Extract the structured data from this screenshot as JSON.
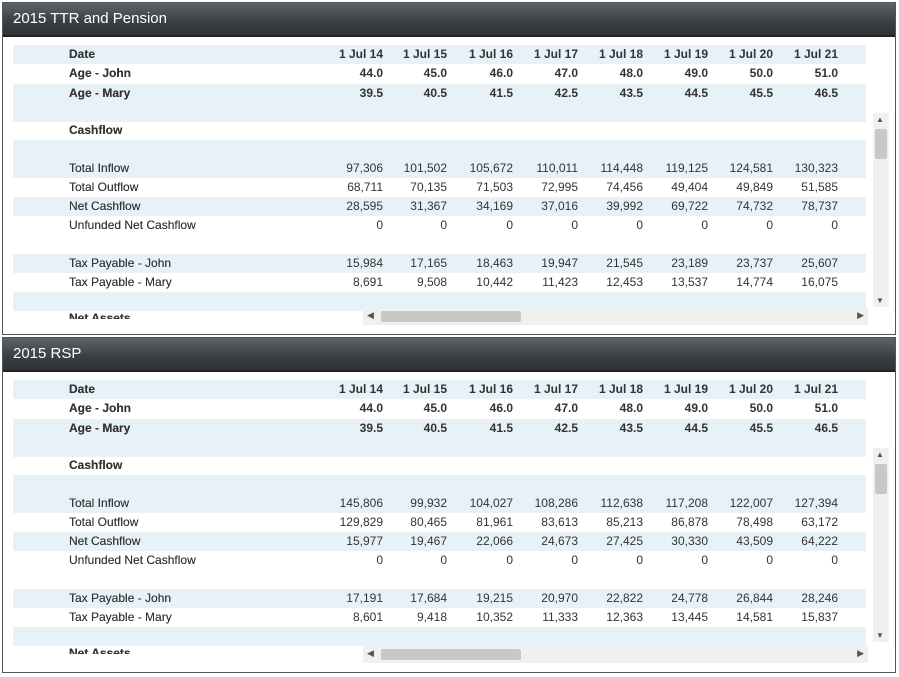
{
  "columns": [
    "1 Jul 14",
    "1 Jul 15",
    "1 Jul 16",
    "1 Jul 17",
    "1 Jul 18",
    "1 Jul 19",
    "1 Jul 20",
    "1 Jul 21"
  ],
  "panels": [
    {
      "title": "2015 TTR and Pension",
      "date_label": "Date",
      "age_rows": [
        {
          "label": "Age - John",
          "values": [
            "44.0",
            "45.0",
            "46.0",
            "47.0",
            "48.0",
            "49.0",
            "50.0",
            "51.0"
          ]
        },
        {
          "label": "Age - Mary",
          "values": [
            "39.5",
            "40.5",
            "41.5",
            "42.5",
            "43.5",
            "44.5",
            "45.5",
            "46.5"
          ]
        }
      ],
      "cashflow_label": "Cashflow",
      "cash_rows": [
        {
          "label": "Total Inflow",
          "values": [
            "97,306",
            "101,502",
            "105,672",
            "110,011",
            "114,448",
            "119,125",
            "124,581",
            "130,323"
          ]
        },
        {
          "label": "Total Outflow",
          "values": [
            "68,711",
            "70,135",
            "71,503",
            "72,995",
            "74,456",
            "49,404",
            "49,849",
            "51,585"
          ]
        },
        {
          "label": "Net Cashflow",
          "values": [
            "28,595",
            "31,367",
            "34,169",
            "37,016",
            "39,992",
            "69,722",
            "74,732",
            "78,737"
          ]
        },
        {
          "label": "Unfunded Net Cashflow",
          "values": [
            "0",
            "0",
            "0",
            "0",
            "0",
            "0",
            "0",
            "0"
          ]
        }
      ],
      "tax_rows": [
        {
          "label": "Tax Payable - John",
          "values": [
            "15,984",
            "17,165",
            "18,463",
            "19,947",
            "21,545",
            "23,189",
            "23,737",
            "25,607"
          ]
        },
        {
          "label": "Tax Payable - Mary",
          "values": [
            "8,691",
            "9,508",
            "10,442",
            "11,423",
            "12,453",
            "13,537",
            "14,774",
            "16,075"
          ]
        }
      ],
      "net_assets_label": "Net Assets"
    },
    {
      "title": "2015 RSP",
      "date_label": "Date",
      "age_rows": [
        {
          "label": "Age - John",
          "values": [
            "44.0",
            "45.0",
            "46.0",
            "47.0",
            "48.0",
            "49.0",
            "50.0",
            "51.0"
          ]
        },
        {
          "label": "Age - Mary",
          "values": [
            "39.5",
            "40.5",
            "41.5",
            "42.5",
            "43.5",
            "44.5",
            "45.5",
            "46.5"
          ]
        }
      ],
      "cashflow_label": "Cashflow",
      "cash_rows": [
        {
          "label": "Total Inflow",
          "values": [
            "145,806",
            "99,932",
            "104,027",
            "108,286",
            "112,638",
            "117,208",
            "122,007",
            "127,394"
          ]
        },
        {
          "label": "Total Outflow",
          "values": [
            "129,829",
            "80,465",
            "81,961",
            "83,613",
            "85,213",
            "86,878",
            "78,498",
            "63,172"
          ]
        },
        {
          "label": "Net Cashflow",
          "values": [
            "15,977",
            "19,467",
            "22,066",
            "24,673",
            "27,425",
            "30,330",
            "43,509",
            "64,222"
          ]
        },
        {
          "label": "Unfunded Net Cashflow",
          "values": [
            "0",
            "0",
            "0",
            "0",
            "0",
            "0",
            "0",
            "0"
          ]
        }
      ],
      "tax_rows": [
        {
          "label": "Tax Payable - John",
          "values": [
            "17,191",
            "17,684",
            "19,215",
            "20,970",
            "22,822",
            "24,778",
            "26,844",
            "28,246"
          ]
        },
        {
          "label": "Tax Payable - Mary",
          "values": [
            "8,601",
            "9,418",
            "10,352",
            "11,333",
            "12,363",
            "13,445",
            "14,581",
            "15,837"
          ]
        }
      ],
      "net_assets_label": "Net Assets"
    }
  ]
}
